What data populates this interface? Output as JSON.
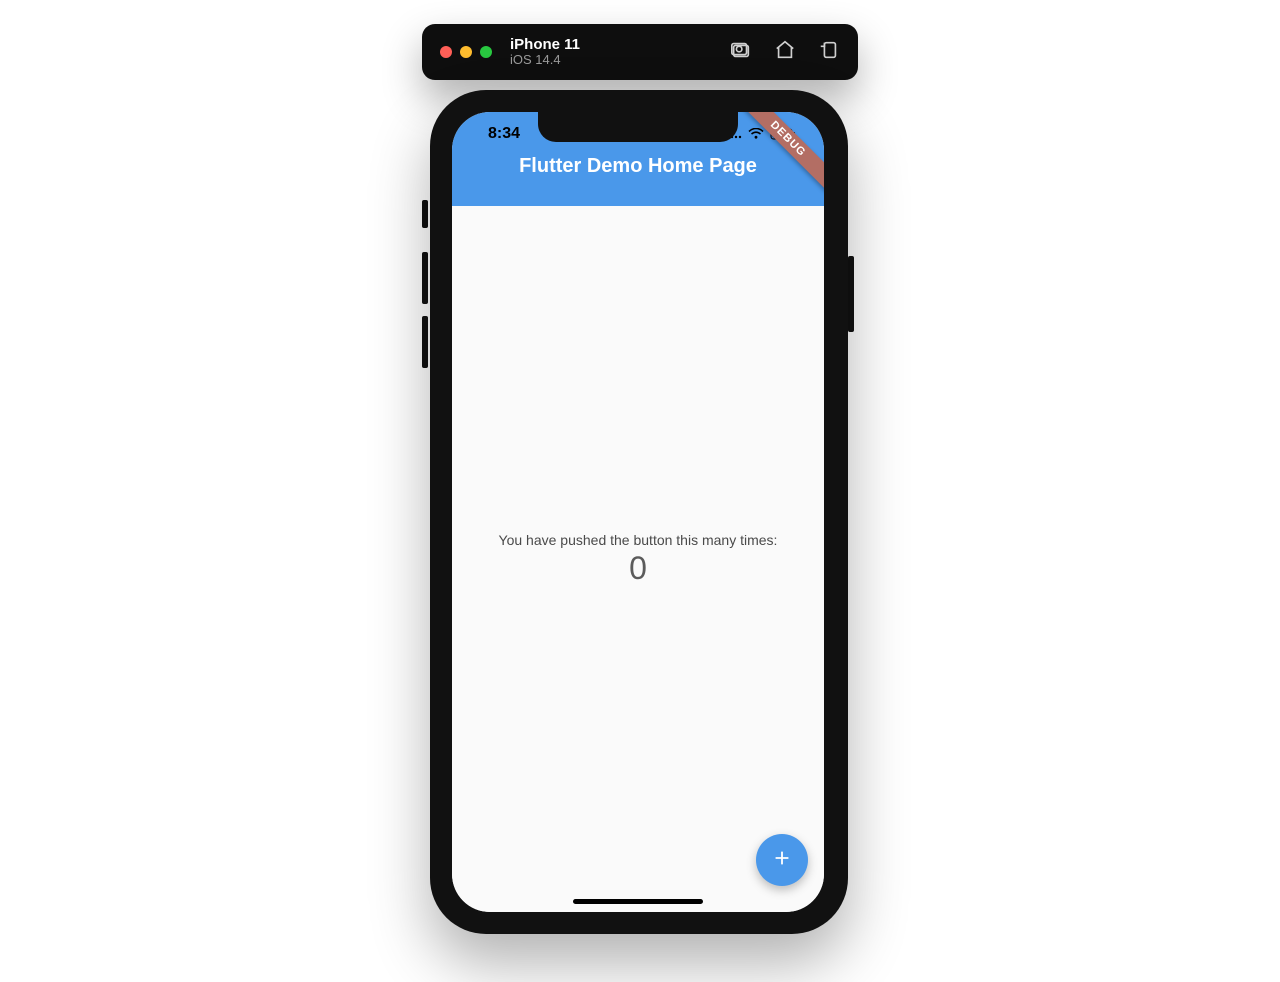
{
  "simulator": {
    "device_name": "iPhone 11",
    "os_version": "iOS 14.4"
  },
  "status_bar": {
    "clock": "8:34"
  },
  "app_bar": {
    "title": "Flutter Demo Home Page",
    "debug_banner": "DEBUG"
  },
  "body": {
    "caption": "You have pushed the button this many times:",
    "count": "0"
  },
  "fab": {
    "icon_name": "plus"
  },
  "colors": {
    "app_primary": "#4a98ea",
    "surface": "#fafafa",
    "debug_ribbon": "#b36e64"
  }
}
